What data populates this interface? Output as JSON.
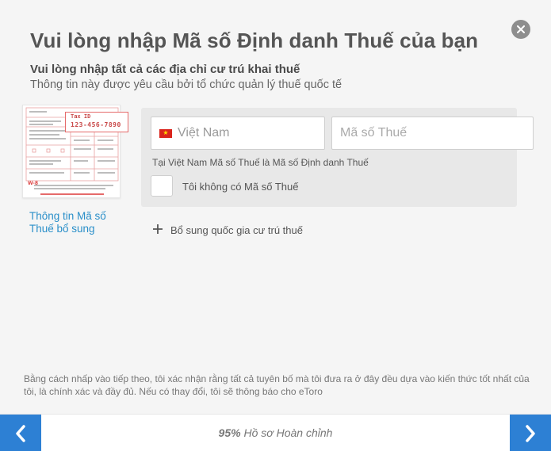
{
  "header": {
    "title": "Vui lòng nhập Mã số Định danh Thuế của bạn",
    "subtitle": "Vui lòng nhập tất cả các địa chỉ cư trú khai thuế",
    "subtext": "Thông tin này được yêu cầu bởi tổ chức quản lý thuế quốc tế"
  },
  "form_image": {
    "tag_label": "Tax ID",
    "tag_number": "123-456-7890"
  },
  "info_link": "Thông tin Mã số Thuế bổ sung",
  "tax_entry": {
    "country": "Việt Nam",
    "tax_placeholder": "Mã số Thuế",
    "hint": "Tại Việt Nam Mã số Thuế là Mã số Định danh Thuế",
    "no_tax_label": "Tôi không có Mã số Thuế",
    "no_tax_checked": false
  },
  "add_country_label": "Bổ sung quốc gia cư trú thuế",
  "disclaimer": "Bằng cách nhấp vào tiếp theo, tôi xác nhận rằng tất cả tuyên bố mà tôi đưa ra ở đây đều dựa vào kiến thức tốt nhất của tôi, là chính xác và đầy đủ. Nếu có thay đổi, tôi sẽ thông báo cho eToro",
  "footer": {
    "progress_percent": "95%",
    "progress_label": "Hồ sơ Hoàn chỉnh"
  },
  "icons": {
    "close": "close-icon",
    "back": "chevron-left-icon",
    "next": "chevron-right-icon",
    "plus": "plus-icon",
    "flag": "vietnam-flag-icon"
  },
  "colors": {
    "accent": "#2d80d4",
    "link": "#2a8fc9",
    "tag": "#e56a6a",
    "flag_red": "#da251d",
    "flag_star": "#ffde00"
  }
}
